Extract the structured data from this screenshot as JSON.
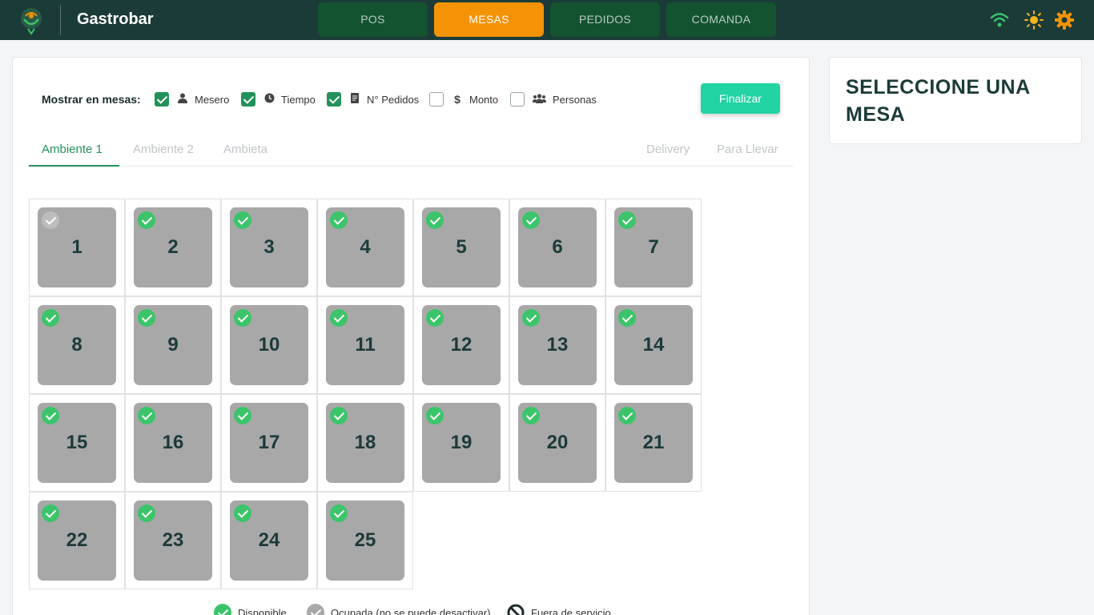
{
  "app": {
    "title": "Gastrobar"
  },
  "nav": {
    "tabs": [
      {
        "label": "POS",
        "active": false
      },
      {
        "label": "MESAS",
        "active": true
      },
      {
        "label": "PEDIDOS",
        "active": false
      },
      {
        "label": "COMANDA",
        "active": false
      }
    ]
  },
  "topbar_icons": [
    "wifi-icon",
    "sun-icon",
    "gear-icon"
  ],
  "colors": {
    "topbar": "#1b3b38",
    "accent_orange": "#f39305",
    "green": "#22925a",
    "finalize": "#22d3a4",
    "available": "#3cc46b",
    "table_bg": "#a8a8a8"
  },
  "options": {
    "label": "Mostrar en mesas:",
    "items": [
      {
        "label": "Mesero",
        "icon": "user-icon",
        "checked": true
      },
      {
        "label": "Tiempo",
        "icon": "clock-icon",
        "checked": true
      },
      {
        "label": "N° Pedidos",
        "icon": "receipt-icon",
        "checked": true
      },
      {
        "label": "Monto",
        "icon": "dollar-icon",
        "checked": false
      },
      {
        "label": "Personas",
        "icon": "users-icon",
        "checked": false
      }
    ],
    "finalize_label": "Finalizar"
  },
  "ambientes": {
    "tabs": [
      "Ambiente 1",
      "Ambiente 2",
      "Ambieta"
    ],
    "active": "Ambiente 1",
    "right_tabs": [
      "Delivery",
      "Para Llevar"
    ]
  },
  "tables": [
    {
      "number": "1",
      "status": "occupied"
    },
    {
      "number": "2",
      "status": "available"
    },
    {
      "number": "3",
      "status": "available"
    },
    {
      "number": "4",
      "status": "available"
    },
    {
      "number": "5",
      "status": "available"
    },
    {
      "number": "6",
      "status": "available"
    },
    {
      "number": "7",
      "status": "available"
    },
    {
      "number": "8",
      "status": "available"
    },
    {
      "number": "9",
      "status": "available"
    },
    {
      "number": "10",
      "status": "available"
    },
    {
      "number": "11",
      "status": "available"
    },
    {
      "number": "12",
      "status": "available"
    },
    {
      "number": "13",
      "status": "available"
    },
    {
      "number": "14",
      "status": "available"
    },
    {
      "number": "15",
      "status": "available"
    },
    {
      "number": "16",
      "status": "available"
    },
    {
      "number": "17",
      "status": "available"
    },
    {
      "number": "18",
      "status": "available"
    },
    {
      "number": "19",
      "status": "available"
    },
    {
      "number": "20",
      "status": "available"
    },
    {
      "number": "21",
      "status": "available"
    },
    {
      "number": "22",
      "status": "available"
    },
    {
      "number": "23",
      "status": "available"
    },
    {
      "number": "24",
      "status": "available"
    },
    {
      "number": "25",
      "status": "available"
    }
  ],
  "legend": [
    {
      "label": "Disponible",
      "icon": "check-circle-green-icon"
    },
    {
      "label": "Ocupada (no se puede desactivar)",
      "icon": "check-circle-grey-icon"
    },
    {
      "label": "Fuera de servicio",
      "icon": "ban-icon"
    }
  ],
  "side": {
    "title": "SELECCIONE UNA MESA"
  }
}
